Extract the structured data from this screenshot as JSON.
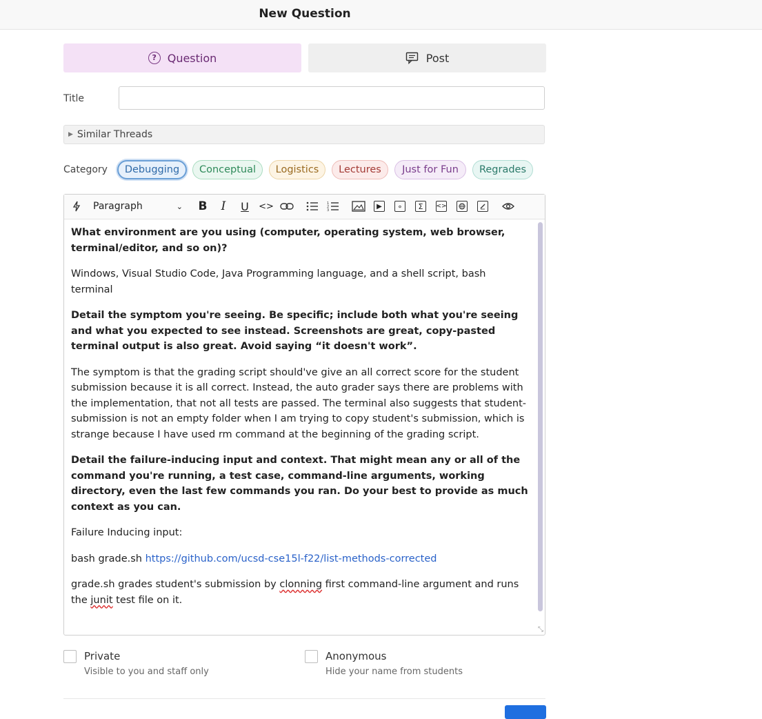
{
  "header": {
    "title": "New Question"
  },
  "type_tabs": [
    {
      "label": "Question",
      "icon": "question-circle-icon",
      "active": true
    },
    {
      "label": "Post",
      "icon": "comment-icon",
      "active": false
    }
  ],
  "form": {
    "title_label": "Title",
    "title_value": "",
    "similar_threads_label": "Similar Threads",
    "category_label": "Category",
    "categories": [
      {
        "label": "Debugging",
        "selected": true,
        "color": "#2f6aa8"
      },
      {
        "label": "Conceptual",
        "color": "#2f8a5a"
      },
      {
        "label": "Logistics",
        "color": "#9a6a20"
      },
      {
        "label": "Lectures",
        "color": "#a33a35"
      },
      {
        "label": "Just for Fun",
        "color": "#7a3d8c"
      },
      {
        "label": "Regrades",
        "color": "#2c7a6a"
      }
    ]
  },
  "editor": {
    "paragraph_style": "Paragraph",
    "toolbar_icons": [
      "lightning-icon",
      "bold-icon",
      "italic-icon",
      "underline-icon",
      "inline-code-icon",
      "link-icon",
      "bullet-list-icon",
      "numbered-list-icon",
      "image-icon",
      "video-icon",
      "attachment-icon",
      "math-icon",
      "code-block-icon",
      "web-embed-icon",
      "drawing-icon",
      "preview-icon"
    ],
    "paragraphs": [
      {
        "bold": true,
        "text": "What environment are you using (computer, operating system, web browser, terminal/editor, and so on)?"
      },
      {
        "bold": false,
        "text": "Windows, Visual Studio Code, Java Programming language, and a shell script, bash terminal"
      },
      {
        "bold": true,
        "text": "Detail the symptom you're seeing. Be specific; include both what you're seeing and what you expected to see instead. Screenshots are great, copy-pasted terminal output is also great. Avoid saying “it doesn't work”."
      },
      {
        "bold": false,
        "text": "The symptom is that the grading script should've give an all correct score for the student submission because it is all correct. Instead, the auto grader says there are problems with the implementation, that not all tests are passed. The terminal also suggests that student-submission is not an empty folder when I am trying to copy student's submission, which is strange because I have used rm command at the beginning of the grading script."
      },
      {
        "bold": true,
        "text": "Detail the failure-inducing input and context. That might mean any or all of the command you're running, a test case, command-line arguments, working directory, even the last few commands you ran. Do your best to provide as much context as you can."
      },
      {
        "bold": false,
        "text": "Failure Inducing input:"
      }
    ],
    "command_prefix": "bash grade.sh ",
    "command_link": "https://github.com/ucsd-cse15l-f22/list-methods-corrected",
    "last_para": {
      "part1": "grade.sh grades student's submission by ",
      "misspelled1": "clonning",
      "part2": " first command-line argument and runs the ",
      "misspelled2": "junit",
      "part3": " test file on it."
    }
  },
  "options": {
    "private_label": "Private",
    "private_desc": "Visible to you and staff only",
    "anonymous_label": "Anonymous",
    "anonymous_desc": "Hide your name from students"
  }
}
